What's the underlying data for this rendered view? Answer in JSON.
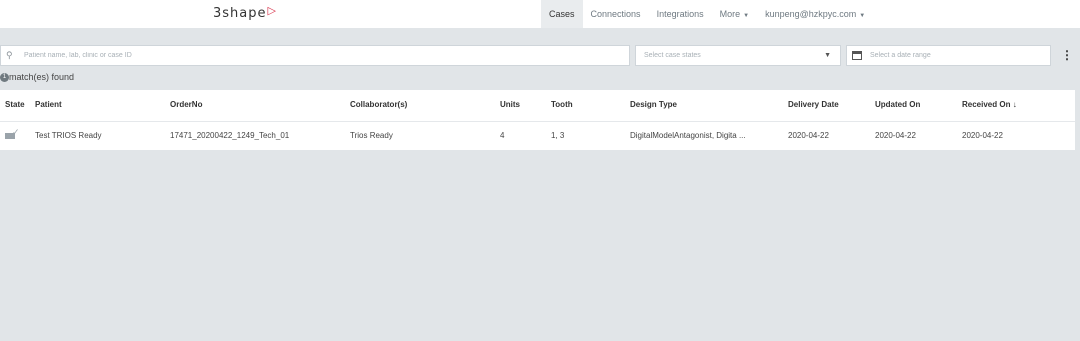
{
  "header": {
    "logo_text": "3shape",
    "nav": {
      "cases": "Cases",
      "connections": "Connections",
      "integrations": "Integrations",
      "more": "More",
      "user": "kunpeng@hzkpyc.com"
    }
  },
  "filters": {
    "search_placeholder": "Patient name, lab, clinic or case ID",
    "state_placeholder": "Select case states",
    "date_placeholder": "Select a date range"
  },
  "results": {
    "count": "1",
    "label": "match(es) found"
  },
  "table": {
    "columns": {
      "state": "State",
      "patient": "Patient",
      "order_no": "OrderNo",
      "collaborators": "Collaborator(s)",
      "units": "Units",
      "tooth": "Tooth",
      "design_type": "Design Type",
      "delivery_date": "Delivery Date",
      "updated_on": "Updated On",
      "received_on": "Received On ↓"
    },
    "rows": [
      {
        "patient": "Test TRIOS Ready",
        "order_no": "17471_20200422_1249_Tech_01",
        "collaborators": "Trios Ready",
        "units": "4",
        "tooth": "1, 3",
        "design_type": "DigitalModelAntagonist, Digita ...",
        "delivery_date": "2020-04-22",
        "updated_on": "2020-04-22",
        "received_on": "2020-04-22"
      }
    ]
  }
}
